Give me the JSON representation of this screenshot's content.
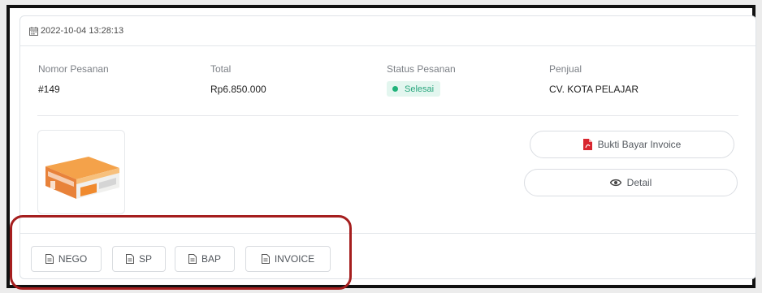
{
  "order": {
    "datetime": "2022-10-04 13:28:13",
    "number_label": "Nomor Pesanan",
    "number_value": "#149",
    "total_label": "Total",
    "total_value": "Rp6.850.000",
    "status_label": "Status Pesanan",
    "status_value": "Selesai",
    "seller_label": "Penjual",
    "seller_value": "CV. KOTA PELAJAR"
  },
  "actions": {
    "proof_label": "Bukti Bayar Invoice",
    "detail_label": "Detail"
  },
  "documents": {
    "nego": "NEGO",
    "sp": "SP",
    "bap": "BAP",
    "invoice": "INVOICE"
  },
  "icons": {
    "header": "calendar-icon",
    "proof": "pdf-file-icon",
    "detail": "eye-icon",
    "document": "document-icon"
  },
  "colors": {
    "status_text": "#29a67d",
    "status_bg": "#e3f6ef",
    "pdf_icon": "#d8262f",
    "highlight": "#a51e1e",
    "frame": "#111111"
  }
}
